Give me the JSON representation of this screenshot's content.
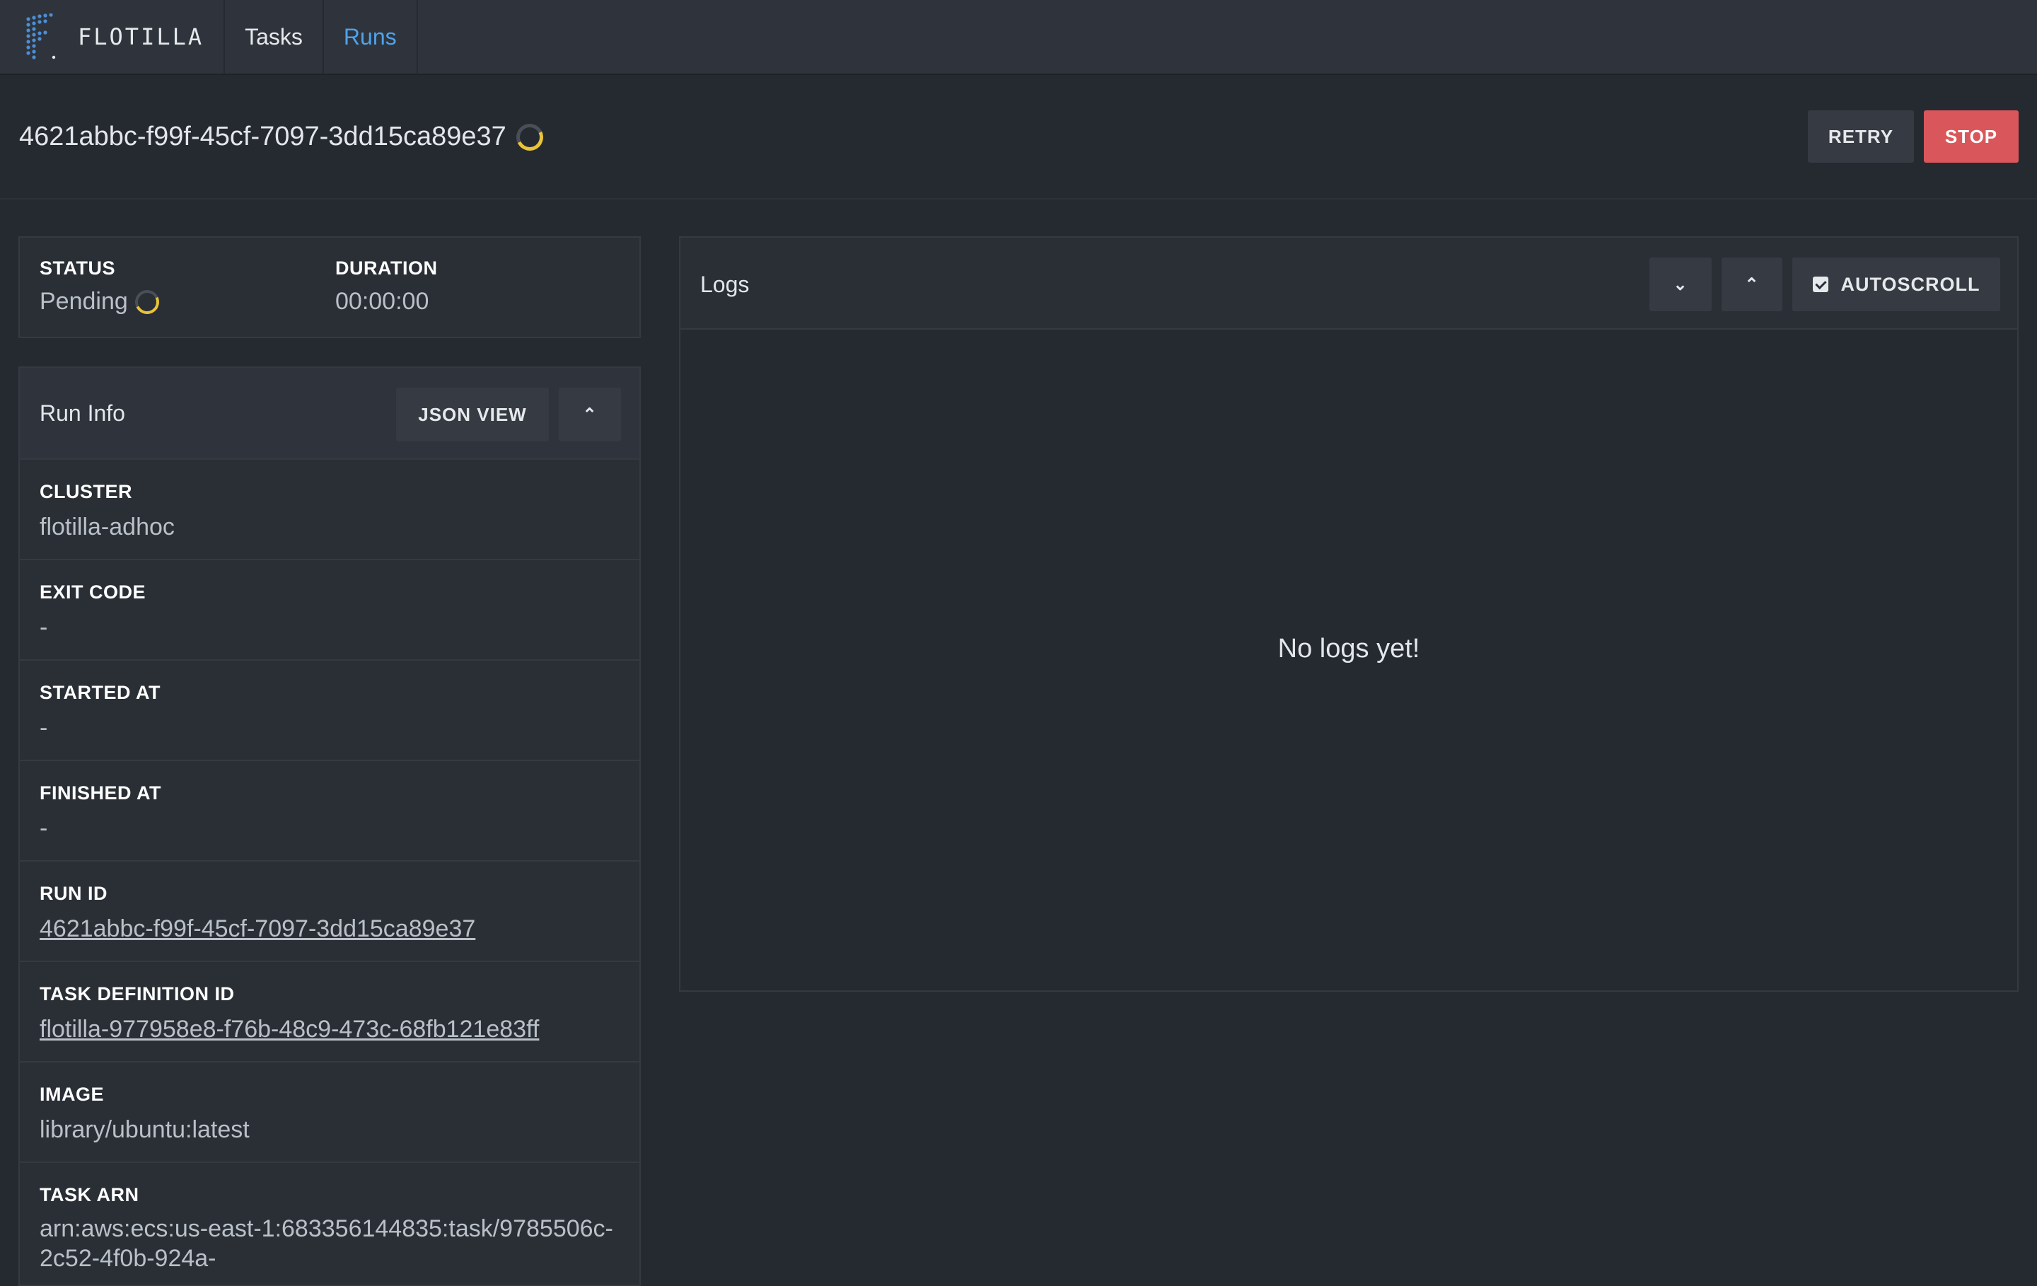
{
  "nav": {
    "brand": "FLOTILLA",
    "items": [
      {
        "label": "Tasks",
        "active": false
      },
      {
        "label": "Runs",
        "active": true
      }
    ]
  },
  "header": {
    "run_title": "4621abbc-f99f-45cf-7097-3dd15ca89e37",
    "retry_label": "RETRY",
    "stop_label": "STOP"
  },
  "status": {
    "status_label": "STATUS",
    "status_value": "Pending",
    "duration_label": "DURATION",
    "duration_value": "00:00:00"
  },
  "run_info": {
    "title": "Run Info",
    "json_view_label": "JSON VIEW",
    "fields": [
      {
        "label": "CLUSTER",
        "value": "flotilla-adhoc"
      },
      {
        "label": "EXIT CODE",
        "value": "-"
      },
      {
        "label": "STARTED AT",
        "value": "-"
      },
      {
        "label": "FINISHED AT",
        "value": "-"
      },
      {
        "label": "RUN ID",
        "value": "4621abbc-f99f-45cf-7097-3dd15ca89e37"
      },
      {
        "label": "TASK DEFINITION ID",
        "value": "flotilla-977958e8-f76b-48c9-473c-68fb121e83ff"
      },
      {
        "label": "IMAGE",
        "value": "library/ubuntu:latest"
      },
      {
        "label": "TASK ARN",
        "value": "arn:aws:ecs:us-east-1:683356144835:task/9785506c-2c52-4f0b-924a-"
      }
    ]
  },
  "logs": {
    "title": "Logs",
    "autoscroll_label": "AUTOSCROLL",
    "autoscroll_checked": true,
    "empty_message": "No logs yet!"
  },
  "colors": {
    "accent": "#4ea3ec",
    "stop": "#d9575b",
    "spinner": "#e9c43a"
  },
  "icons": [
    "flotilla-logo-icon",
    "spinner-icon",
    "chevron-down-icon",
    "chevron-up-icon",
    "checkbox-icon"
  ]
}
